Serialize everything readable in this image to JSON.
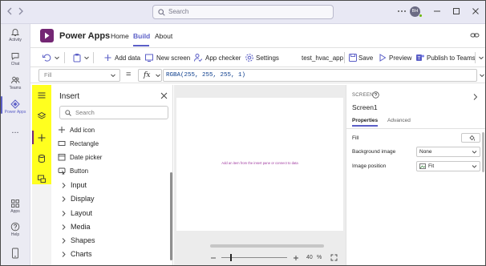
{
  "titlebar": {
    "search_placeholder": "Search",
    "avatar_initials": "BH"
  },
  "rail": {
    "items": [
      {
        "label": "Activity",
        "icon": "bell-icon"
      },
      {
        "label": "Chat",
        "icon": "chat-icon"
      },
      {
        "label": "Teams",
        "icon": "teams-icon"
      },
      {
        "label": "Power Apps",
        "icon": "power-apps-icon",
        "active": true
      },
      {
        "label": "...",
        "icon": "more-icon"
      },
      {
        "label": "Apps",
        "icon": "apps-icon"
      },
      {
        "label": "Help",
        "icon": "help-icon"
      }
    ]
  },
  "app": {
    "title": "Power Apps",
    "tabs": [
      {
        "label": "Home"
      },
      {
        "label": "Build",
        "active": true
      },
      {
        "label": "About"
      }
    ]
  },
  "toolbar": {
    "add_data": "Add data",
    "new_screen": "New screen",
    "app_checker": "App checker",
    "settings": "Settings",
    "app_name": "test_hvac_app",
    "save": "Save",
    "preview": "Preview",
    "publish": "Publish to Teams"
  },
  "formula": {
    "property": "Fill",
    "eq": "=",
    "fx": "fx",
    "value": "RGBA(255, 255, 255, 1)"
  },
  "insert": {
    "title": "Insert",
    "search_placeholder": "Search",
    "items": [
      {
        "label": "Add icon",
        "icon": "plus-icon"
      },
      {
        "label": "Rectangle",
        "icon": "rectangle-icon"
      },
      {
        "label": "Date picker",
        "icon": "calendar-icon"
      },
      {
        "label": "Button",
        "icon": "button-icon"
      }
    ],
    "categories": [
      "Input",
      "Display",
      "Layout",
      "Media",
      "Shapes",
      "Charts"
    ]
  },
  "canvas": {
    "hint": "Add an item from the insert pane or connect to data",
    "zoom": "40",
    "zoom_unit": "%",
    "zoom_fraction": 0.4
  },
  "properties": {
    "section_label": "SCREEN",
    "screen_name": "Screen1",
    "tabs": {
      "properties": "Properties",
      "advanced": "Advanced"
    },
    "rows": {
      "fill": {
        "label": "Fill"
      },
      "background_image": {
        "label": "Background image",
        "value": "None"
      },
      "image_position": {
        "label": "Image position",
        "value": "Fit"
      }
    }
  },
  "colors": {
    "accent": "#5b5fc7",
    "powerapps_purple": "#742774",
    "highlight_yellow": "#ffff1f"
  }
}
